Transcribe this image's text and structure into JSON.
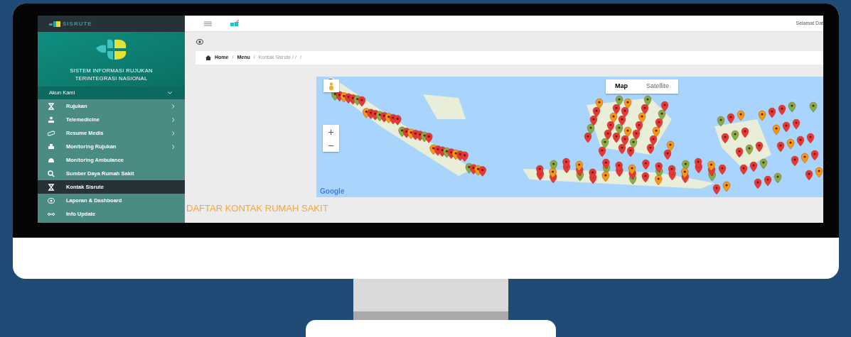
{
  "sidebar": {
    "brand": "SISRUTE",
    "title_lines": [
      "SISTEM INFORMASI RUJUKAN",
      "TERINTEGRASI NASIONAL"
    ],
    "account": "Akun Kami",
    "items": [
      {
        "label": "Rujukan",
        "submenu": true,
        "selected": false
      },
      {
        "label": "Telemedicine",
        "submenu": true,
        "selected": false
      },
      {
        "label": "Resume Medis",
        "submenu": true,
        "selected": false
      },
      {
        "label": "Monitoring Rujukan",
        "submenu": true,
        "selected": false
      },
      {
        "label": "Monitoring Ambulance",
        "submenu": false,
        "selected": false
      },
      {
        "label": "Sumber Daya Rumah Sakit",
        "submenu": false,
        "selected": false
      },
      {
        "label": "Kontak Sisrute",
        "submenu": false,
        "selected": true
      },
      {
        "label": "Laporan & Dashboard",
        "submenu": false,
        "selected": false
      },
      {
        "label": "Info Update",
        "submenu": false,
        "selected": false
      }
    ]
  },
  "topbar": {
    "greeting": "Selamat Dat"
  },
  "breadcrumb": [
    {
      "label": "Home",
      "separator": "/",
      "active": false
    },
    {
      "label": "Menu",
      "separator": "/",
      "active": false
    },
    {
      "label": "Kontak Sisrute / /",
      "separator": "/",
      "active": true
    }
  ],
  "map": {
    "map_types": [
      {
        "label": "Map",
        "selected": true
      },
      {
        "label": "Satellite",
        "selected": false
      }
    ],
    "zoom_in": "+",
    "zoom_out": "−",
    "logo": "Google"
  },
  "heading": "DAFTAR KONTAK RUMAH SAKIT"
}
